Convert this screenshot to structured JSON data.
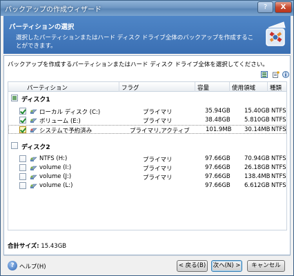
{
  "window": {
    "title": "バックアップの作成ウィザード",
    "help_glyph": "?",
    "close_glyph": "X"
  },
  "header": {
    "title": "パーティションの選択",
    "description": "選択したパーティションまたはハード ディスク ドライブ全体のバックアップを作成することができます。",
    "accent_color": "#3f76bb"
  },
  "instruction": "バックアップを作成するパーティションまたはハード ディスク ドライブ全体を選択してください。",
  "toolbar_icons": [
    "details-icon",
    "properties-icon",
    "info-icon"
  ],
  "columns": {
    "partition": "パーティション",
    "flag": "フラグ",
    "capacity": "容量",
    "used": "使用領域",
    "type": "種類"
  },
  "disks": [
    {
      "name": "ディスク1",
      "partitions": [
        {
          "name": "ローカル ディスク (C:)",
          "flag": "プライマリ",
          "capacity": "35.94GB",
          "used": "15.40GB",
          "type": "NTFS"
        },
        {
          "name": "ボリューム (E:)",
          "flag": "プライマリ",
          "capacity": "38.48GB",
          "used": "5.810GB",
          "type": "NTFS"
        },
        {
          "name": "システムで予約済み",
          "flag": "プライマリ,アクティブ",
          "capacity": "101.9MB",
          "used": "30.14MB",
          "type": "NTFS"
        }
      ]
    },
    {
      "name": "ディスク2",
      "partitions": [
        {
          "name": "NTFS (H:)",
          "flag": "プライマリ",
          "capacity": "97.66GB",
          "used": "70.94GB",
          "type": "NTFS"
        },
        {
          "name": "volume (I:)",
          "flag": "プライマリ",
          "capacity": "97.66GB",
          "used": "26.18GB",
          "type": "NTFS"
        },
        {
          "name": "volume (J:)",
          "flag": "プライマリ",
          "capacity": "97.66GB",
          "used": "138.4MB",
          "type": "NTFS"
        },
        {
          "name": "volume (L:)",
          "flag": "",
          "capacity": "97.66GB",
          "used": "6.612GB",
          "type": "NTFS"
        }
      ]
    }
  ],
  "total_label": "合計サイズ:",
  "total_value": "15.43GB",
  "buttons": {
    "help": "ヘルプ(H)",
    "help_glyph": "?",
    "back": "< 戻る(B)",
    "next": "次へ(N) >",
    "cancel": "キャンセル"
  }
}
